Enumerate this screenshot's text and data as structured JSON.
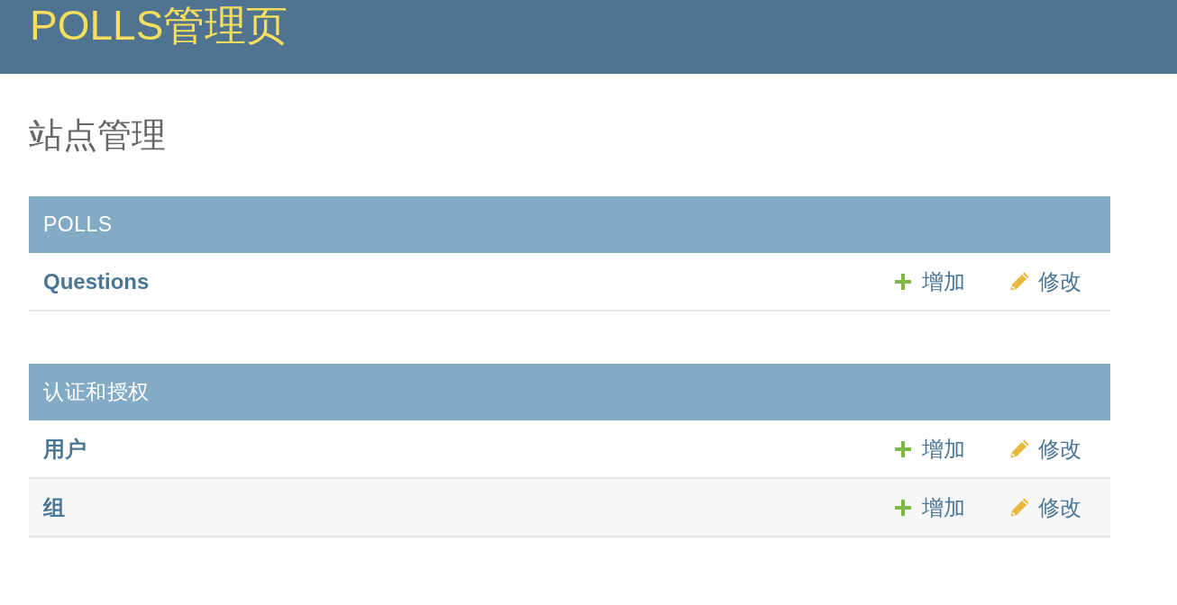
{
  "header": {
    "title": "POLLS管理页"
  },
  "page": {
    "title": "站点管理"
  },
  "modules": [
    {
      "caption": "POLLS",
      "models": [
        {
          "name": "Questions",
          "add_label": "增加",
          "change_label": "修改"
        }
      ]
    },
    {
      "caption": "认证和授权",
      "models": [
        {
          "name": "用户",
          "add_label": "增加",
          "change_label": "修改"
        },
        {
          "name": "组",
          "add_label": "增加",
          "change_label": "修改"
        }
      ]
    }
  ]
}
